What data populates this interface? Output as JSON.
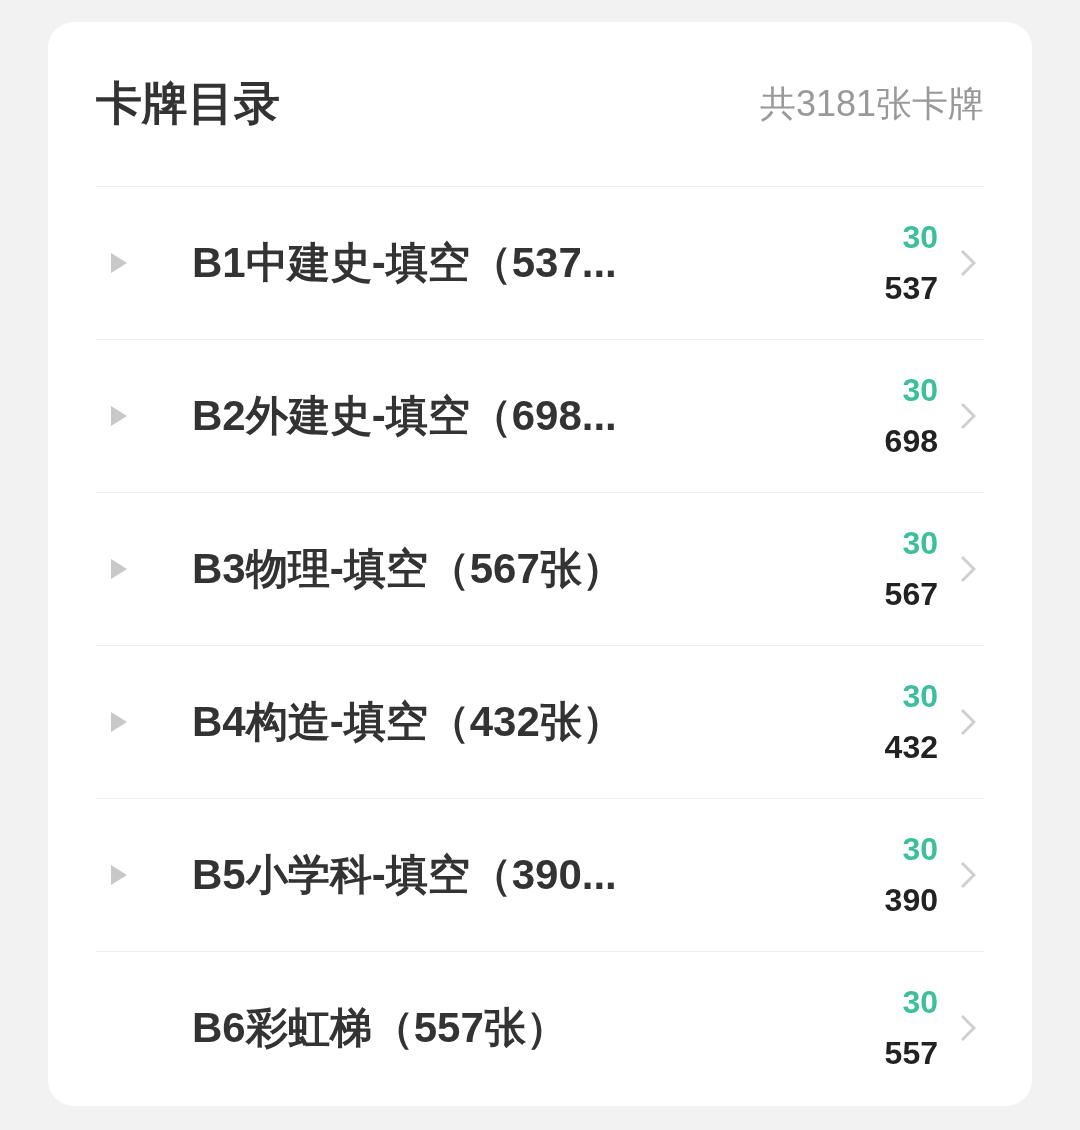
{
  "header": {
    "title": "卡牌目录",
    "total": "共3181张卡牌"
  },
  "decks": [
    {
      "name": "B1中建史-填空（537...",
      "expandable": true,
      "due": "30",
      "count": "537"
    },
    {
      "name": "B2外建史-填空（698...",
      "expandable": true,
      "due": "30",
      "count": "698"
    },
    {
      "name": "B3物理-填空（567张）",
      "expandable": true,
      "due": "30",
      "count": "567"
    },
    {
      "name": "B4构造-填空（432张）",
      "expandable": true,
      "due": "30",
      "count": "432"
    },
    {
      "name": "B5小学科-填空（390...",
      "expandable": true,
      "due": "30",
      "count": "390"
    },
    {
      "name": "B6彩虹梯（557张）",
      "expandable": false,
      "due": "30",
      "count": "557"
    }
  ]
}
